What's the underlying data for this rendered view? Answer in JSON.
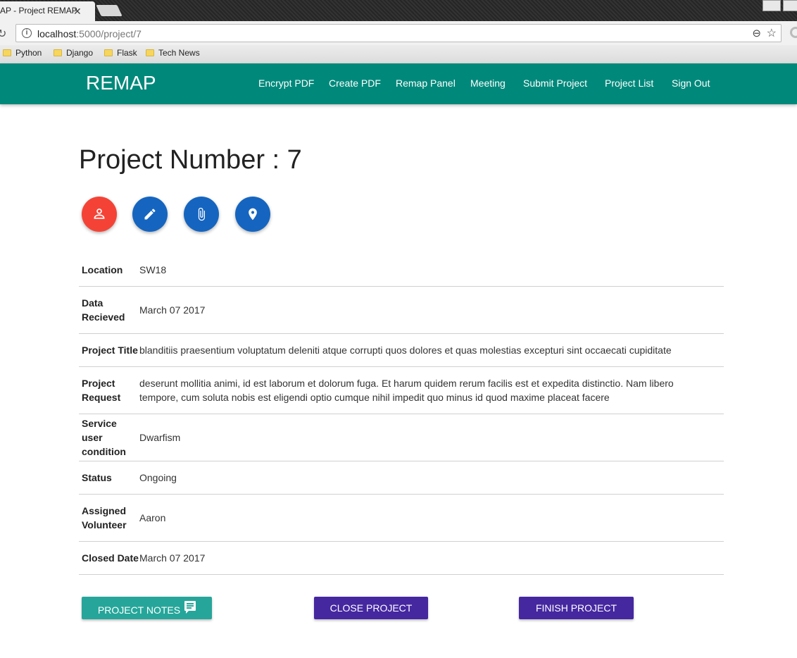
{
  "browser": {
    "tab_title": "AP - Project REMAP",
    "url_host": "localhost",
    "url_path": ":5000/project/7",
    "bookmarks": [
      "Python",
      "Django",
      "Flask",
      "Tech News"
    ]
  },
  "navbar": {
    "brand": "REMAP",
    "items": [
      "Encrypt PDF",
      "Create PDF",
      "Remap Panel",
      "Meeting",
      "Submit Project",
      "Project List",
      "Sign Out"
    ],
    "color": "#00897b"
  },
  "page": {
    "title": "Project Number : 7",
    "action_icons": [
      {
        "name": "person-icon",
        "color": "#f44336"
      },
      {
        "name": "pencil-icon",
        "color": "#1565c0"
      },
      {
        "name": "attachment-icon",
        "color": "#1565c0"
      },
      {
        "name": "location-icon",
        "color": "#1565c0"
      }
    ]
  },
  "details": [
    {
      "label": "Location",
      "value": "SW18"
    },
    {
      "label": "Data Recieved",
      "value": "March 07 2017"
    },
    {
      "label": "Project Title",
      "value": "blanditiis praesentium voluptatum deleniti atque corrupti quos dolores et quas molestias excepturi sint occaecati cupiditate"
    },
    {
      "label": "Project Request",
      "value": "deserunt mollitia animi, id est laborum et dolorum fuga. Et harum quidem rerum facilis est et expedita distinctio. Nam libero tempore, cum soluta nobis est eligendi optio cumque nihil impedit quo minus id quod maxime placeat facere"
    },
    {
      "label": "Service user condition",
      "value": "Dwarfism"
    },
    {
      "label": "Status",
      "value": "Ongoing"
    },
    {
      "label": "Assigned Volunteer",
      "value": "Aaron"
    },
    {
      "label": "Closed Date",
      "value": "March 07 2017"
    }
  ],
  "buttons": {
    "notes": "PROJECT NOTES",
    "close": "CLOSE PROJECT",
    "finish": "FINISH PROJECT"
  }
}
